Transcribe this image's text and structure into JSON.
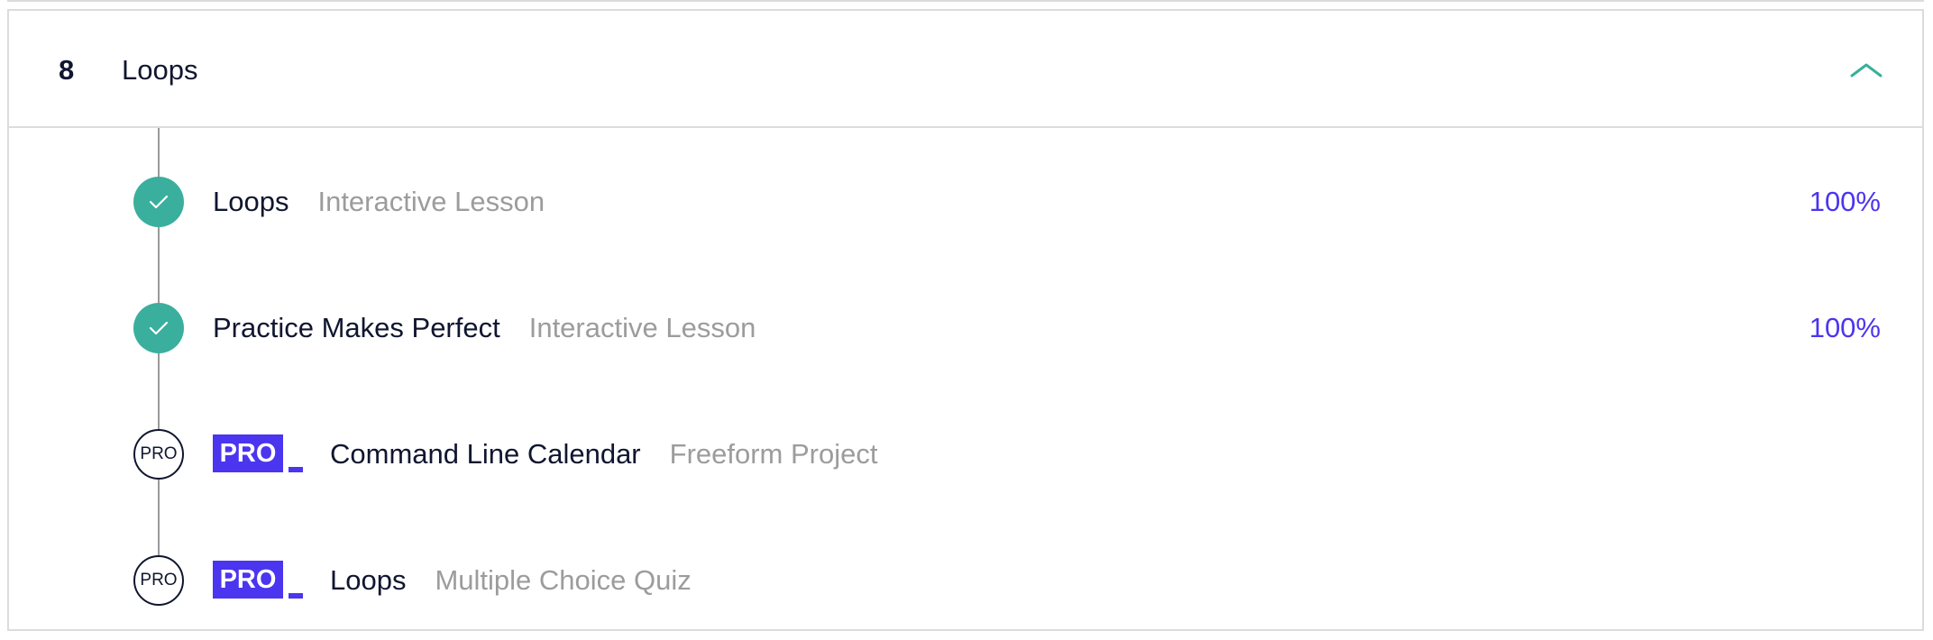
{
  "section": {
    "number": "8",
    "title": "Loops",
    "collapse_icon": "chevron-up-icon",
    "accent_color": "#3aaf9d"
  },
  "items": [
    {
      "status": "completed",
      "status_icon": "check-icon",
      "title": "Loops",
      "type": "Interactive Lesson",
      "progress": "100%"
    },
    {
      "status": "completed",
      "status_icon": "check-icon",
      "title": "Practice Makes Perfect",
      "type": "Interactive Lesson",
      "progress": "100%"
    },
    {
      "status": "pro",
      "marker_label": "PRO",
      "badge_label": "PRO",
      "title": "Command Line Calendar",
      "type": "Freeform Project"
    },
    {
      "status": "pro",
      "marker_label": "PRO",
      "badge_label": "PRO",
      "title": "Loops",
      "type": "Multiple Choice Quiz"
    }
  ],
  "colors": {
    "completed": "#3aaf9d",
    "pro_badge": "#4b35ef",
    "progress_text": "#4b35ef",
    "muted_text": "#9c9c9c",
    "primary_text": "#10162f"
  }
}
